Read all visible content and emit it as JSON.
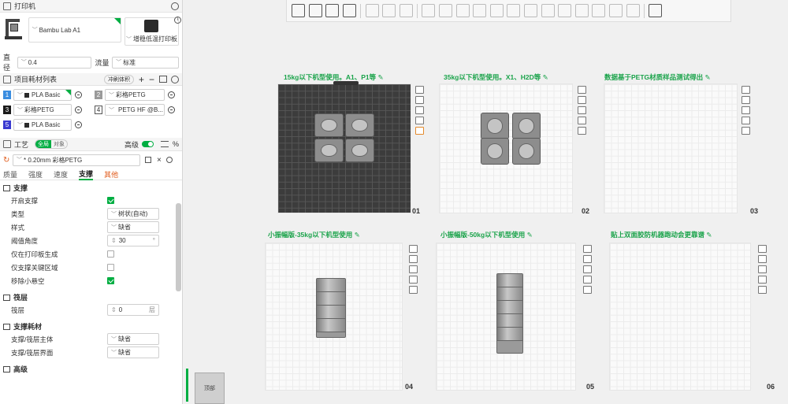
{
  "printer": {
    "section_title": "打印机",
    "name": "Bambu Lab A1",
    "plate_type": "增稳低温打印板",
    "nozzle_label": "直径",
    "nozzle_value": "0.4",
    "flow_label": "流量",
    "flow_value": "标准"
  },
  "filaments": {
    "section_title": "项目耗材列表",
    "flush_button": "冲刷体积",
    "items": [
      {
        "num": "1",
        "name": "PLA Basic",
        "color": "#3a8de0"
      },
      {
        "num": "2",
        "name": "彩格PETG",
        "color": "#9a9a9a"
      },
      {
        "num": "3",
        "name": "彩格PETG",
        "color": "#1a1a1a"
      },
      {
        "num": "4",
        "name": "PETG HF @B...",
        "color": "#ffffff"
      },
      {
        "num": "5",
        "name": "PLA Basic",
        "color": "#3a3ad0"
      }
    ]
  },
  "process": {
    "section_title": "工艺",
    "toggle_global": "全局",
    "toggle_object": "对象",
    "advanced_label": "高级",
    "preset": "* 0.20mm 彩格PETG",
    "tabs": [
      "质量",
      "强度",
      "速度",
      "支撑",
      "其他"
    ],
    "active_tab": "支撑"
  },
  "support": {
    "group_title": "支撑",
    "rows": [
      {
        "label": "开启支撑",
        "kind": "check",
        "checked": true
      },
      {
        "label": "类型",
        "kind": "select",
        "value": "树状(自动)"
      },
      {
        "label": "样式",
        "kind": "select",
        "value": "缺省"
      },
      {
        "label": "阈值角度",
        "kind": "spin",
        "value": "30",
        "unit": "°"
      },
      {
        "label": "仅在打印板生成",
        "kind": "check",
        "checked": false
      },
      {
        "label": "仅支撑关键区域",
        "kind": "check",
        "checked": false
      },
      {
        "label": "移除小悬空",
        "kind": "check",
        "checked": true
      }
    ]
  },
  "raft": {
    "group_title": "筏层",
    "label": "筏层",
    "value": "0",
    "unit": "层"
  },
  "support_filament": {
    "group_title": "支撑耗材",
    "rows": [
      {
        "label": "支撑/筏层主体",
        "value": "缺省"
      },
      {
        "label": "支撑/筏层界面",
        "value": "缺省"
      }
    ]
  },
  "advanced_group": "高级",
  "viewcube_label": "顶部",
  "plates": [
    {
      "num": "01",
      "label": "15kg以下机型使用。A1、P1等"
    },
    {
      "num": "02",
      "label": "35kg以下机型使用。X1、H2D等"
    },
    {
      "num": "03",
      "label": "数据基于PETG材质样品测试得出"
    },
    {
      "num": "04",
      "label": "小振幅版-35kg以下机型使用"
    },
    {
      "num": "05",
      "label": "小振幅版-50kg以下机型使用"
    },
    {
      "num": "06",
      "label": "贴上双面胶防机器跑动会更靠谱"
    }
  ],
  "colors": {
    "accent": "#00ae42",
    "plate_label": "#1aa34a"
  }
}
